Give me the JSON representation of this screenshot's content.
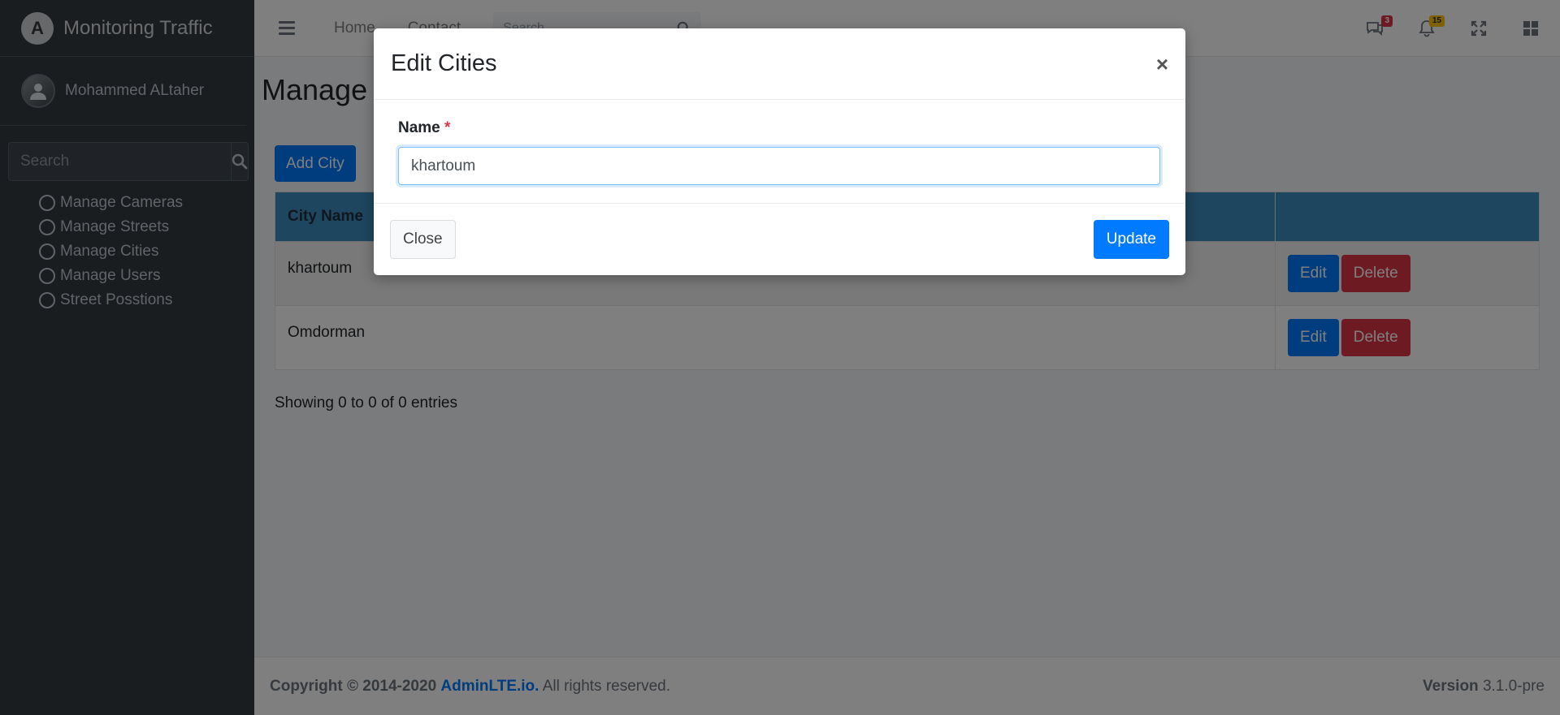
{
  "brand": {
    "logo_letter": "A",
    "title": "Monitoring Traffic"
  },
  "user": {
    "name": "Mohammed ALtaher"
  },
  "sidebar": {
    "search_placeholder": "Search",
    "items": [
      {
        "label": "Manage Cameras"
      },
      {
        "label": "Manage Streets"
      },
      {
        "label": "Manage Cities"
      },
      {
        "label": "Manage Users"
      },
      {
        "label": "Street Posstions"
      }
    ]
  },
  "topbar": {
    "links": [
      {
        "label": "Home"
      },
      {
        "label": "Contact"
      }
    ],
    "search_placeholder": "Search",
    "messages_badge": "3",
    "notifications_badge": "15"
  },
  "main": {
    "title": "Manage Cities",
    "add_button": "Add City",
    "table": {
      "headers": [
        "City Name",
        ""
      ],
      "rows": [
        {
          "name": "khartoum",
          "edit": "Edit",
          "delete": "Delete"
        },
        {
          "name": "Omdorman",
          "edit": "Edit",
          "delete": "Delete"
        }
      ]
    },
    "entries_info": "Showing 0 to 0 of 0 entries"
  },
  "footer": {
    "copyright_prefix": "Copyright © 2014-2020",
    "link_text": "AdminLTE.io.",
    "rights": "All rights reserved.",
    "version_label": "Version",
    "version_value": "3.1.0-pre"
  },
  "modal": {
    "title": "Edit Cities",
    "close_symbol": "×",
    "field_label": "Name",
    "required_mark": "*",
    "field_value": "khartoum",
    "close_button": "Close",
    "update_button": "Update"
  },
  "colors": {
    "primary": "#007bff",
    "danger": "#dc3545",
    "sidebar_bg": "#343a40",
    "table_header": "#3c8dbc"
  }
}
